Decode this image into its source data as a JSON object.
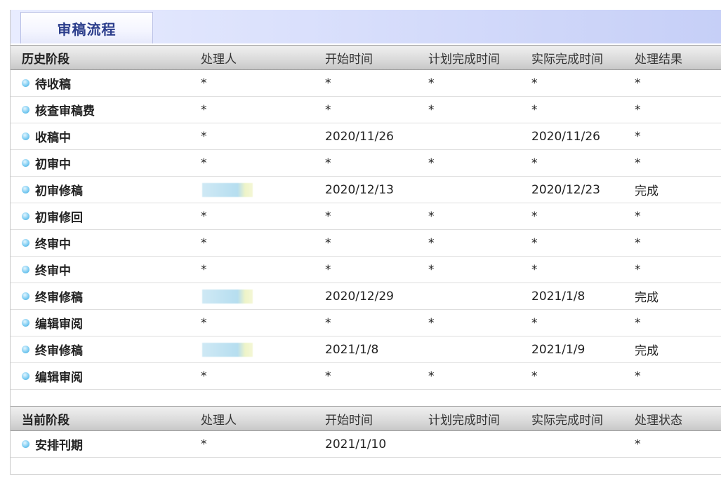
{
  "tab": {
    "title": "审稿流程"
  },
  "history": {
    "headers": [
      "历史阶段",
      "处理人",
      "开始时间",
      "计划完成时间",
      "实际完成时间",
      "处理结果"
    ],
    "rows": [
      {
        "stage": "待收稿",
        "handler": "*",
        "start": "*",
        "plan": "*",
        "actual": "*",
        "result": "*"
      },
      {
        "stage": "核查审稿费",
        "handler": "*",
        "start": "*",
        "plan": "*",
        "actual": "*",
        "result": "*"
      },
      {
        "stage": "收稿中",
        "handler": "*",
        "start": "2020/11/26",
        "plan": "",
        "actual": "2020/11/26",
        "result": "*"
      },
      {
        "stage": "初审中",
        "handler": "*",
        "start": "*",
        "plan": "*",
        "actual": "*",
        "result": "*"
      },
      {
        "stage": "初审修稿",
        "handler": "",
        "start": "2020/12/13",
        "plan": "",
        "actual": "2020/12/23",
        "result": "完成"
      },
      {
        "stage": "初审修回",
        "handler": "*",
        "start": "*",
        "plan": "*",
        "actual": "*",
        "result": "*"
      },
      {
        "stage": "终审中",
        "handler": "*",
        "start": "*",
        "plan": "*",
        "actual": "*",
        "result": "*"
      },
      {
        "stage": "终审中",
        "handler": "*",
        "start": "*",
        "plan": "*",
        "actual": "*",
        "result": "*"
      },
      {
        "stage": "终审修稿",
        "handler": "",
        "start": "2020/12/29",
        "plan": "",
        "actual": "2021/1/8",
        "result": "完成"
      },
      {
        "stage": "编辑审阅",
        "handler": "*",
        "start": "*",
        "plan": "*",
        "actual": "*",
        "result": "*"
      },
      {
        "stage": "终审修稿",
        "handler": "",
        "start": "2021/1/8",
        "plan": "",
        "actual": "2021/1/9",
        "result": "完成"
      },
      {
        "stage": "编辑审阅",
        "handler": "*",
        "start": "*",
        "plan": "*",
        "actual": "*",
        "result": "*"
      }
    ]
  },
  "current": {
    "headers": [
      "当前阶段",
      "处理人",
      "开始时间",
      "计划完成时间",
      "实际完成时间",
      "处理状态"
    ],
    "rows": [
      {
        "stage": "安排刊期",
        "handler": "*",
        "start": "2021/1/10",
        "plan": "",
        "actual": "",
        "result": "*"
      }
    ]
  }
}
